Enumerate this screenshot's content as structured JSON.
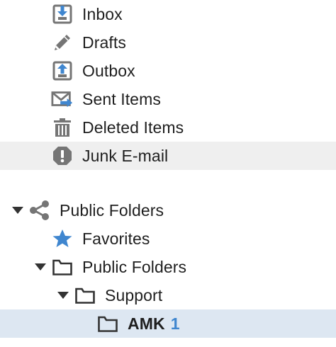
{
  "folders": {
    "inbox": {
      "label": "Inbox",
      "icon": "inbox-icon"
    },
    "drafts": {
      "label": "Drafts",
      "icon": "pencil-icon"
    },
    "outbox": {
      "label": "Outbox",
      "icon": "outbox-icon"
    },
    "sent": {
      "label": "Sent Items",
      "icon": "sent-items-icon"
    },
    "deleted": {
      "label": "Deleted Items",
      "icon": "trash-icon"
    },
    "junk": {
      "label": "Junk E-mail",
      "icon": "exclamation-circle-icon"
    }
  },
  "public_root": {
    "label": "Public Folders",
    "icon": "share-icon",
    "expanded": true
  },
  "favorites": {
    "label": "Favorites",
    "icon": "star-icon"
  },
  "public_folders": {
    "label": "Public Folders",
    "icon": "folder-icon",
    "expanded": true
  },
  "support": {
    "label": "Support",
    "icon": "folder-icon",
    "expanded": true
  },
  "amk": {
    "label": "AMK",
    "unread": "1",
    "icon": "folder-icon",
    "selected": true
  },
  "colors": {
    "icon_gray": "#757575",
    "accent_blue": "#3f86cf",
    "selected_bg": "#dde7f2",
    "hover_bg": "#efefef"
  }
}
